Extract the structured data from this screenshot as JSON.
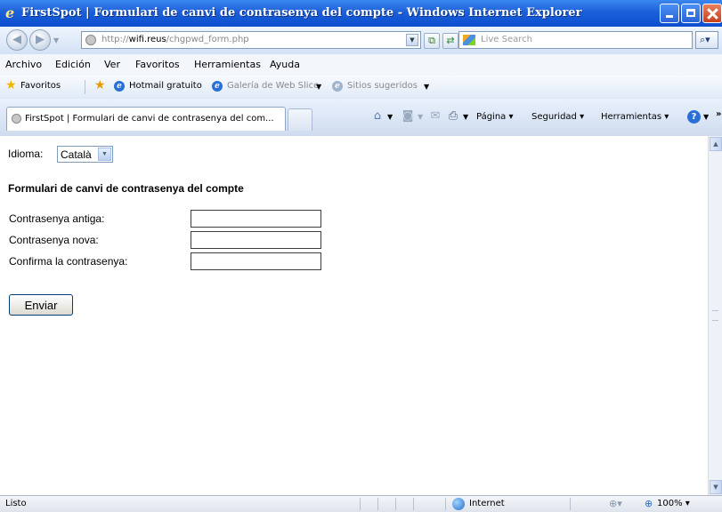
{
  "window": {
    "title": "FirstSpot | Formulari de canvi de contrasenya del compte - Windows Internet Explorer"
  },
  "address": {
    "url_host": "wifi.reus",
    "url_prefix": "http://",
    "url_path": "/chgpwd_form.php",
    "search_placeholder": "Live Search"
  },
  "menu": {
    "items": [
      "Archivo",
      "Edición",
      "Ver",
      "Favoritos",
      "Herramientas",
      "Ayuda"
    ]
  },
  "favorites": {
    "label": "Favoritos",
    "hotmail": "Hotmail gratuito",
    "webslice": "Galería de Web Slice",
    "suggested": "Sitios sugeridos"
  },
  "tabs": {
    "active_label": "FirstSpot | Formulari de canvi de contrasenya del com..."
  },
  "commands": {
    "page": "Página",
    "security": "Seguridad",
    "tools": "Herramientas"
  },
  "page": {
    "language_label": "Idioma:",
    "language_value": "Català",
    "form_title": "Formulari de canvi de contrasenya del compte",
    "fields": [
      {
        "label": "Contrasenya antiga:"
      },
      {
        "label": "Contrasenya nova:"
      },
      {
        "label": "Confirma la contrasenya:"
      }
    ],
    "submit_label": "Enviar"
  },
  "status": {
    "text": "Listo",
    "zone": "Internet",
    "zoom": "100%"
  },
  "colors": {
    "titlebar": "#1d5fd9",
    "accent": "#2a6fd6"
  }
}
